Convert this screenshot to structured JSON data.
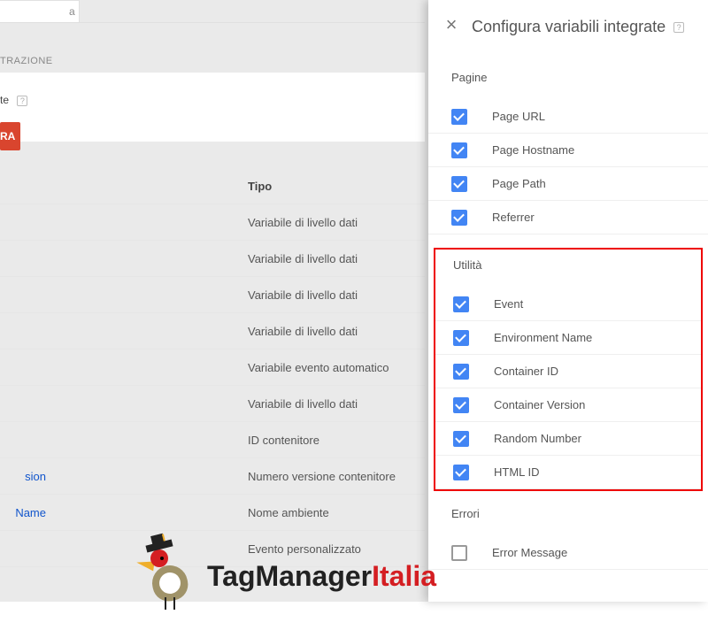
{
  "bg": {
    "tab_stub": "a",
    "nav_label": "TRAZIONE",
    "te_label": "te",
    "button_stub": "RA",
    "header_tipo": "Tipo",
    "rows": [
      {
        "name": "",
        "tipo": "Variabile di livello dati"
      },
      {
        "name": "",
        "tipo": "Variabile di livello dati"
      },
      {
        "name": "",
        "tipo": "Variabile di livello dati"
      },
      {
        "name": "",
        "tipo": "Variabile di livello dati"
      },
      {
        "name": "",
        "tipo": "Variabile evento automatico"
      },
      {
        "name": "",
        "tipo": "Variabile di livello dati"
      },
      {
        "name": "",
        "tipo": "ID contenitore"
      },
      {
        "name": "sion",
        "tipo": "Numero versione contenitore"
      },
      {
        "name": "Name",
        "tipo": "Nome ambiente"
      },
      {
        "name": "",
        "tipo": "Evento personalizzato"
      }
    ]
  },
  "panel": {
    "title": "Configura variabili integrate",
    "sections": [
      {
        "name": "Pagine",
        "highlighted": false,
        "items": [
          {
            "label": "Page URL",
            "checked": true
          },
          {
            "label": "Page Hostname",
            "checked": true
          },
          {
            "label": "Page Path",
            "checked": true
          },
          {
            "label": "Referrer",
            "checked": true
          }
        ]
      },
      {
        "name": "Utilità",
        "highlighted": true,
        "items": [
          {
            "label": "Event",
            "checked": true
          },
          {
            "label": "Environment Name",
            "checked": true
          },
          {
            "label": "Container ID",
            "checked": true
          },
          {
            "label": "Container Version",
            "checked": true
          },
          {
            "label": "Random Number",
            "checked": true
          },
          {
            "label": "HTML ID",
            "checked": true
          }
        ]
      },
      {
        "name": "Errori",
        "highlighted": false,
        "items": [
          {
            "label": "Error Message",
            "checked": false
          }
        ]
      }
    ]
  },
  "logo": {
    "t1": "TagManager",
    "t2": "Italia"
  }
}
